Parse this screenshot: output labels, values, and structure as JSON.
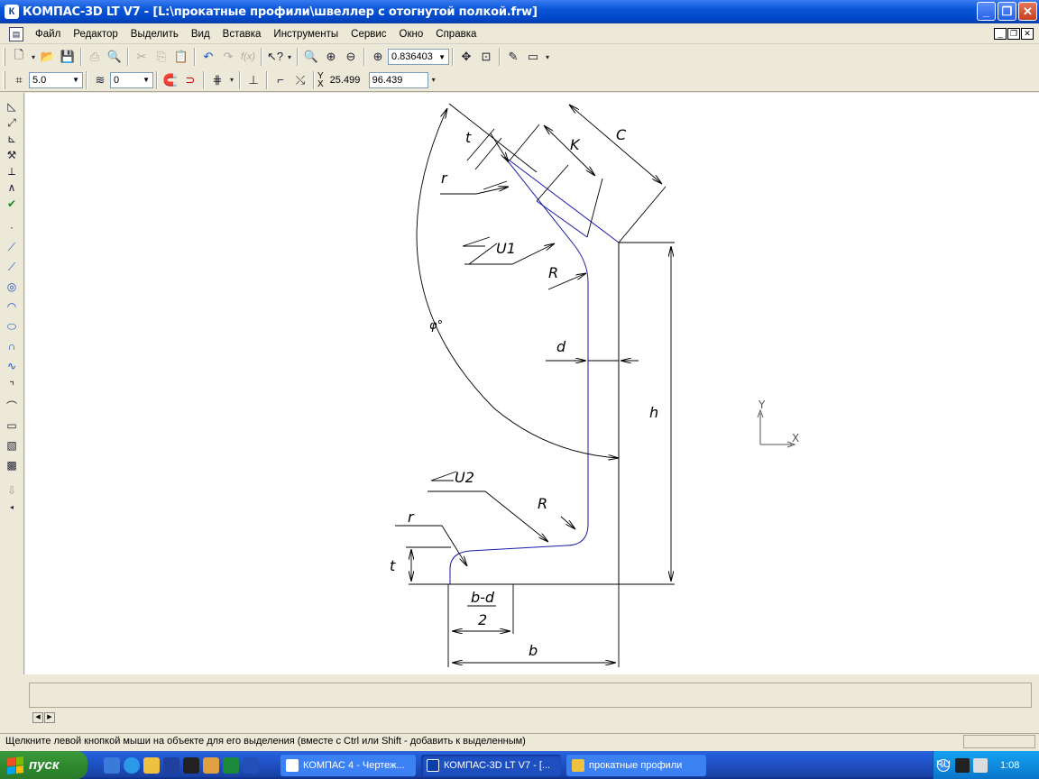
{
  "window": {
    "app_icon": "kompas-logo-icon",
    "title": "КОМПАС-3D LT V7 - [L:\\прокатные профили\\швеллер с отогнутой полкой.frw]",
    "buttons": [
      "minimize-icon",
      "maximize-icon",
      "close-icon"
    ]
  },
  "menu": {
    "items": [
      "Файл",
      "Редактор",
      "Выделить",
      "Вид",
      "Вставка",
      "Инструменты",
      "Сервис",
      "Окно",
      "Справка"
    ]
  },
  "toolbar_top": {
    "zoom_value": "0.836403"
  },
  "toolbar_current": {
    "step_value": "5.0",
    "layer_value": "0",
    "coord_label_y": "Y",
    "coord_label_x": "X",
    "coord_x": "25.499",
    "coord_y": "96.439"
  },
  "drawing": {
    "labels": {
      "t_top": "t",
      "k": "K",
      "c": "C",
      "r_top": "r",
      "u1": "U1",
      "r_big_top": "R",
      "phi": "φ°",
      "d": "d",
      "h": "h",
      "u2": "U2",
      "r_big_bottom": "R",
      "r_bottom": "r",
      "t_bottom": "t",
      "frac_num": "b-d",
      "frac_den": "2",
      "b": "b"
    },
    "axes": {
      "y": "Y",
      "x": "X"
    }
  },
  "status": {
    "hint": "Щелкните левой кнопкой мыши на объекте для его выделения (вместе с Ctrl или Shift - добавить к выделенным)"
  },
  "taskbar": {
    "start_label": "пуск",
    "tasks": [
      "КОМПАС 4 - Чертеж...",
      "КОМПАС-3D LT V7 - [...",
      "прокатные профили"
    ],
    "lang": "RU",
    "clock": "1:08"
  }
}
